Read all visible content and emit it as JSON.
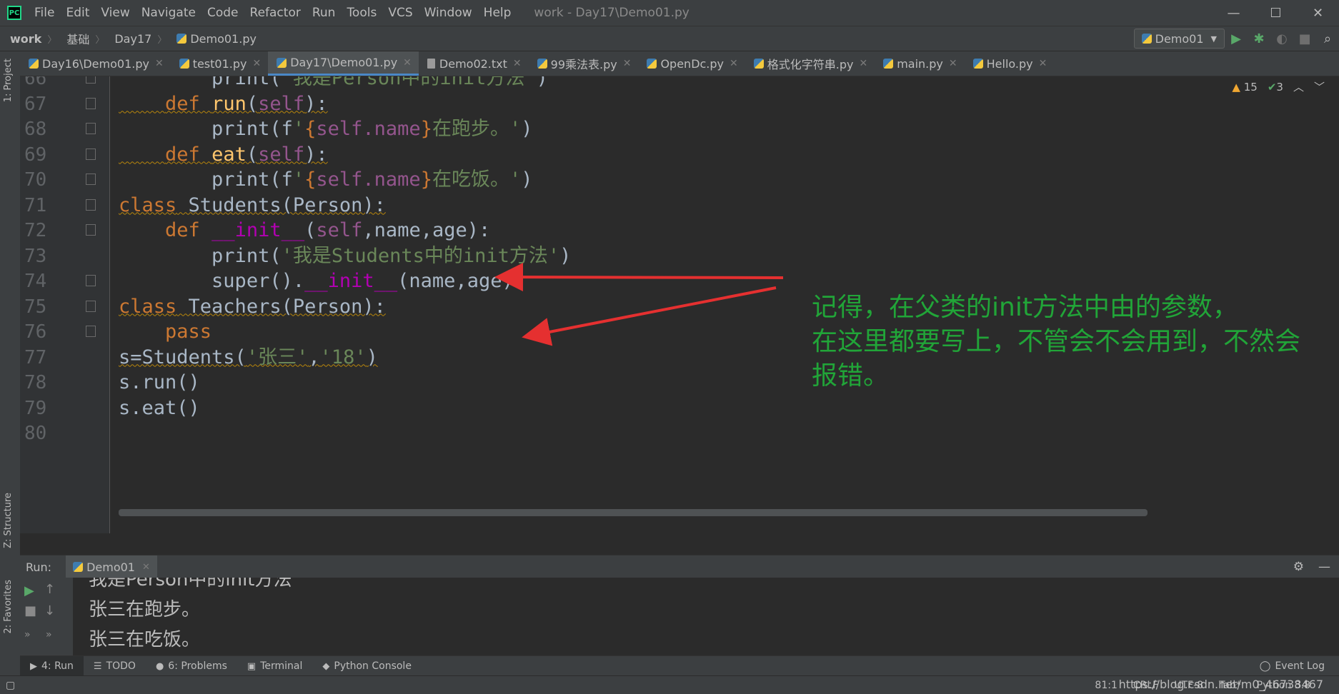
{
  "app": {
    "menu": [
      "File",
      "Edit",
      "View",
      "Navigate",
      "Code",
      "Refactor",
      "Run",
      "Tools",
      "VCS",
      "Window",
      "Help"
    ],
    "window_title": "work - Day17\\Demo01.py"
  },
  "nav": {
    "breadcrumbs": [
      "work",
      "基础",
      "Day17",
      "Demo01.py"
    ],
    "run_config": "Demo01"
  },
  "tabs": [
    {
      "label": "Day16\\Demo01.py",
      "type": "py"
    },
    {
      "label": "test01.py",
      "type": "py"
    },
    {
      "label": "Day17\\Demo01.py",
      "type": "py",
      "active": true
    },
    {
      "label": "Demo02.txt",
      "type": "txt"
    },
    {
      "label": "99乘法表.py",
      "type": "py"
    },
    {
      "label": "OpenDc.py",
      "type": "py"
    },
    {
      "label": "格式化字符串.py",
      "type": "py"
    },
    {
      "label": "main.py",
      "type": "py"
    },
    {
      "label": "Hello.py",
      "type": "py"
    }
  ],
  "inspection": {
    "warnings": "15",
    "typos": "3"
  },
  "editor": {
    "lines": [
      {
        "n": "66",
        "text": "        print('我是Person中的init方法')"
      },
      {
        "n": "67",
        "text": "    def run(self):"
      },
      {
        "n": "68",
        "text": "        print(f'{self.name}在跑步。')"
      },
      {
        "n": "69",
        "text": "    def eat(self):"
      },
      {
        "n": "70",
        "text": "        print(f'{self.name}在吃饭。')"
      },
      {
        "n": "71",
        "text": "class Students(Person):"
      },
      {
        "n": "72",
        "text": "    def __init__(self,name,age):"
      },
      {
        "n": "73",
        "text": "        print('我是Students中的init方法')"
      },
      {
        "n": "74",
        "text": "        super().__init__(name,age)"
      },
      {
        "n": "75",
        "text": "class Teachers(Person):"
      },
      {
        "n": "76",
        "text": "    pass"
      },
      {
        "n": "77",
        "text": "s=Students('张三','18')"
      },
      {
        "n": "78",
        "text": "s.run()"
      },
      {
        "n": "79",
        "text": "s.eat()"
      },
      {
        "n": "80",
        "text": ""
      }
    ]
  },
  "annotation": {
    "lines": [
      "记得，在父类的init方法中由的参数，",
      "在这里都要写上，不管会不会用到，不然会",
      "报错。"
    ],
    "color": "#21a538"
  },
  "run": {
    "label": "Run:",
    "tab": "Demo01",
    "output": [
      "我是Person中的init方法",
      "张三在跑步。",
      "张三在吃饭。"
    ]
  },
  "bottom_tabs": [
    {
      "label": "4: Run",
      "icon": "play-icon"
    },
    {
      "label": "TODO",
      "icon": "list-icon"
    },
    {
      "label": "6: Problems",
      "icon": "info-icon"
    },
    {
      "label": "Terminal",
      "icon": "terminal-icon"
    },
    {
      "label": "Python Console",
      "icon": "python-icon"
    }
  ],
  "event_log": "Event Log",
  "status": {
    "position": "81:1",
    "line_sep": "CRLF",
    "encoding": "UTF-8",
    "indent": "Tab*",
    "interpreter": "Python 3.8",
    "watermark": "https://blog.csdn.net/m0_46738467"
  },
  "side_labels": {
    "project": "1: Project",
    "structure": "Z: Structure",
    "favorites": "2: Favorites"
  }
}
